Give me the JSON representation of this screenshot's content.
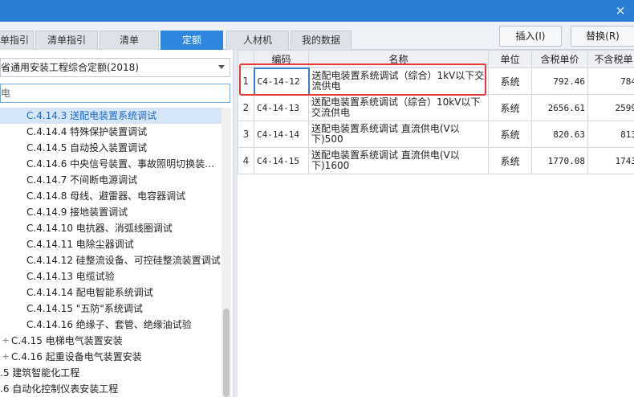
{
  "window": {
    "close_glyph": "×"
  },
  "tabs": [
    {
      "label": "单指引"
    },
    {
      "label": "清单指引"
    },
    {
      "label": "清单"
    },
    {
      "label": "定额"
    },
    {
      "label": "人材机"
    },
    {
      "label": "我的数据"
    }
  ],
  "actions": {
    "insert": "插入(I)",
    "replace": "替换(R)"
  },
  "left": {
    "quota_library": "省通用安装工程综合定额(2018)",
    "search_value": "电",
    "tree": [
      {
        "label": "C.4.14.3 送配电装置系统调试",
        "indent": 33,
        "selected": true
      },
      {
        "label": "C.4.14.4 特殊保护装置调试",
        "indent": 33
      },
      {
        "label": "C.4.14.5 自动投入装置调试",
        "indent": 33
      },
      {
        "label": "C.4.14.6 中央信号装置、事故照明切换装…",
        "indent": 33
      },
      {
        "label": "C.4.14.7 不间断电源调试",
        "indent": 33
      },
      {
        "label": "C.4.14.8 母线、避雷器、电容器调试",
        "indent": 33
      },
      {
        "label": "C.4.14.9 接地装置调试",
        "indent": 33
      },
      {
        "label": "C.4.14.10 电抗器、消弧线圈调试",
        "indent": 33
      },
      {
        "label": "C.4.14.11 电除尘器调试",
        "indent": 33
      },
      {
        "label": "C.4.14.12 硅整流设备、可控硅整流装置调试",
        "indent": 33
      },
      {
        "label": "C.4.14.13 电缆试验",
        "indent": 33
      },
      {
        "label": "C.4.14.14 配电智能系统调试",
        "indent": 33
      },
      {
        "label": "C.4.14.15 \"五防\"系统调试",
        "indent": 33
      },
      {
        "label": "C.4.14.16 绝缘子、套管、绝缘油试验",
        "indent": 33
      },
      {
        "label": "C.4.15 电梯电气装置安装",
        "indent": 14,
        "expander": "+"
      },
      {
        "label": "C.4.16 起重设备电气装置安装",
        "indent": 14,
        "expander": "+"
      },
      {
        "label": ".5 建筑智能化工程",
        "indent": 0
      },
      {
        "label": ".6 自动化控制仪表安装工程",
        "indent": 0
      }
    ]
  },
  "grid": {
    "columns": [
      "",
      "编码",
      "名称",
      "单位",
      "含税单价",
      "不含税单"
    ],
    "rows": [
      {
        "idx": "1",
        "code": "C4-14-12",
        "name": "送配电装置系统调试（综合）1kV以下交流供电",
        "unit": "系统",
        "price_tax": "792.46",
        "price_notax": "784"
      },
      {
        "idx": "2",
        "code": "C4-14-13",
        "name": "送配电装置系统调试（综合）10kV以下交流供电",
        "unit": "系统",
        "price_tax": "2656.61",
        "price_notax": "2599"
      },
      {
        "idx": "3",
        "code": "C4-14-14",
        "name": "送配电装置系统调试 直流供电(V以下)500",
        "unit": "系统",
        "price_tax": "820.63",
        "price_notax": "813"
      },
      {
        "idx": "4",
        "code": "C4-14-15",
        "name": "送配电装置系统调试 直流供电(V以下)1600",
        "unit": "系统",
        "price_tax": "1770.08",
        "price_notax": "1743"
      }
    ]
  },
  "colors": {
    "accent": "#2e86de",
    "title_bar": "#2a7fd4",
    "highlight_box": "#e53935",
    "selected_row": "#d5e6f8"
  }
}
